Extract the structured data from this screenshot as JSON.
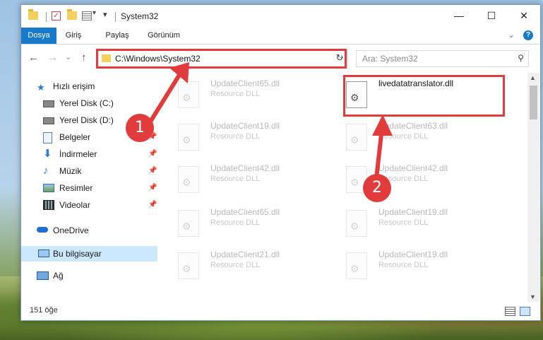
{
  "window": {
    "title": "System32",
    "minimize_glyph": "—",
    "maximize_glyph": "☐",
    "close_glyph": "✕"
  },
  "quick_access_toolbar": {
    "properties_glyph": "✓",
    "dropdown_glyph": "▾"
  },
  "ribbon": {
    "tabs": [
      "Dosya",
      "Giriş",
      "Paylaş",
      "Görünüm"
    ],
    "active_tab": "Dosya",
    "expand_glyph": "⌄",
    "help_glyph": "?"
  },
  "navigation": {
    "back_glyph": "←",
    "forward_glyph": "→",
    "recent_glyph": "⌄",
    "up_glyph": "↑",
    "address": "C:\\Windows\\System32",
    "address_dropdown_glyph": "⌄",
    "refresh_glyph": "↻",
    "search_placeholder": "Ara: System32",
    "search_glyph": "⚲"
  },
  "sidebar": {
    "pin_glyph": "📌",
    "items": [
      {
        "label": "Hızlı erişim",
        "icon": "star-icon",
        "root": true,
        "pinned": false
      },
      {
        "label": "Yerel Disk (C:)",
        "icon": "drive-icon",
        "root": false,
        "pinned": false
      },
      {
        "label": "Yerel Disk (D:)",
        "icon": "drive-icon",
        "root": false,
        "pinned": false
      },
      {
        "label": "Belgeler",
        "icon": "documents-icon",
        "root": false,
        "pinned": true
      },
      {
        "label": "İndirmeler",
        "icon": "download-icon",
        "root": false,
        "pinned": true
      },
      {
        "label": "Müzik",
        "icon": "music-icon",
        "root": false,
        "pinned": true
      },
      {
        "label": "Resimler",
        "icon": "pictures-icon",
        "root": false,
        "pinned": true
      },
      {
        "label": "Videolar",
        "icon": "videos-icon",
        "root": false,
        "pinned": true
      },
      {
        "label": "OneDrive",
        "icon": "cloud-icon",
        "root": true,
        "pinned": false
      },
      {
        "label": "Bu bilgisayar",
        "icon": "computer-icon",
        "root": true,
        "pinned": false,
        "selected": true
      },
      {
        "label": "Ağ",
        "icon": "network-icon",
        "root": true,
        "pinned": false
      }
    ]
  },
  "files": [
    {
      "name": "UpdateClient65.dll",
      "type": "Resource DLL",
      "highlighted": false
    },
    {
      "name": "livedatatranslator.dll",
      "type": "",
      "highlighted": true
    },
    {
      "name": "UpdateClient19.dll",
      "type": "Resource DLL",
      "highlighted": false
    },
    {
      "name": "UpdateClient63.dll",
      "type": "Resource DLL",
      "highlighted": false
    },
    {
      "name": "UpdateClient42.dll",
      "type": "Resource DLL",
      "highlighted": false
    },
    {
      "name": "UpdateClient42.dll",
      "type": "Resource DLL",
      "highlighted": false
    },
    {
      "name": "UpdateClient65.dll",
      "type": "Resource DLL",
      "highlighted": false
    },
    {
      "name": "UpdateClient19.dll",
      "type": "Resource DLL",
      "highlighted": false
    },
    {
      "name": "UpdateClient21.dll",
      "type": "Resource DLL",
      "highlighted": false
    },
    {
      "name": "UpdateClient19.dll",
      "type": "Resource DLL",
      "highlighted": false
    }
  ],
  "scrollbar": {
    "up_glyph": "▲",
    "down_glyph": "▼"
  },
  "status": {
    "item_count": "151 öğe"
  },
  "annotations": {
    "step1_label": "1",
    "step2_label": "2",
    "highlight_color": "#e23b3b"
  }
}
